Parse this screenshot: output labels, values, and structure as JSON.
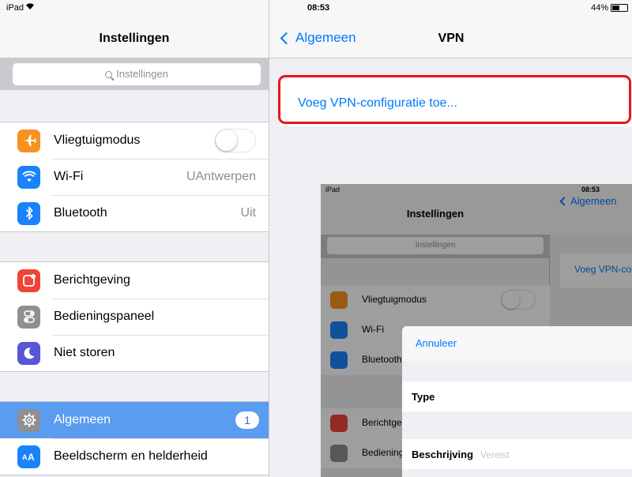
{
  "left": {
    "status": {
      "carrier": "iPad"
    },
    "title": "Instellingen",
    "search_placeholder": "Instellingen",
    "groups": [
      [
        {
          "label": "Vliegtuigmodus",
          "icon": "airplane-icon",
          "color": "#f7931e",
          "toggle": false
        },
        {
          "label": "Wi-Fi",
          "icon": "wifi-icon",
          "color": "#1a82fb",
          "value": "UAntwerpen"
        },
        {
          "label": "Bluetooth",
          "icon": "bluetooth-icon",
          "color": "#1a82fb",
          "value": "Uit"
        }
      ],
      [
        {
          "label": "Berichtgeving",
          "icon": "notifications-icon",
          "color": "#f0443a"
        },
        {
          "label": "Bedieningspaneel",
          "icon": "control-center-icon",
          "color": "#8e8e93"
        },
        {
          "label": "Niet storen",
          "icon": "moon-icon",
          "color": "#5856d6"
        }
      ],
      [
        {
          "label": "Algemeen",
          "icon": "gear-icon",
          "color": "#8e8e93",
          "badge": "1",
          "selected": true
        },
        {
          "label": "Beeldscherm en helderheid",
          "icon": "display-brightness-icon",
          "color": "#1a82fb"
        }
      ]
    ]
  },
  "right": {
    "status": {
      "time": "08:53",
      "battery": "44%"
    },
    "back_label": "Algemeen",
    "title": "VPN",
    "add_vpn_label": "Voeg VPN-configuratie toe..."
  },
  "embedded": {
    "status": {
      "carrier": "iPad",
      "time": "08:53"
    },
    "title": "Instellingen",
    "search_placeholder": "Instellingen",
    "back_label": "Algemeen",
    "vpn_link": "Voeg VPN-configuratie toe...",
    "rows": [
      "Vliegtuigmodus",
      "Wi-Fi",
      "Bluetooth",
      "Berichtgeving",
      "Bedieningspaneel"
    ],
    "modal": {
      "cancel": "Annuleer",
      "type_label": "Type",
      "desc_label": "Beschrijving",
      "desc_placeholder": "Vereist"
    }
  },
  "colors": {
    "accent": "#007aff",
    "selected_row": "#5a9cf0",
    "highlight_border": "#e8141a"
  }
}
